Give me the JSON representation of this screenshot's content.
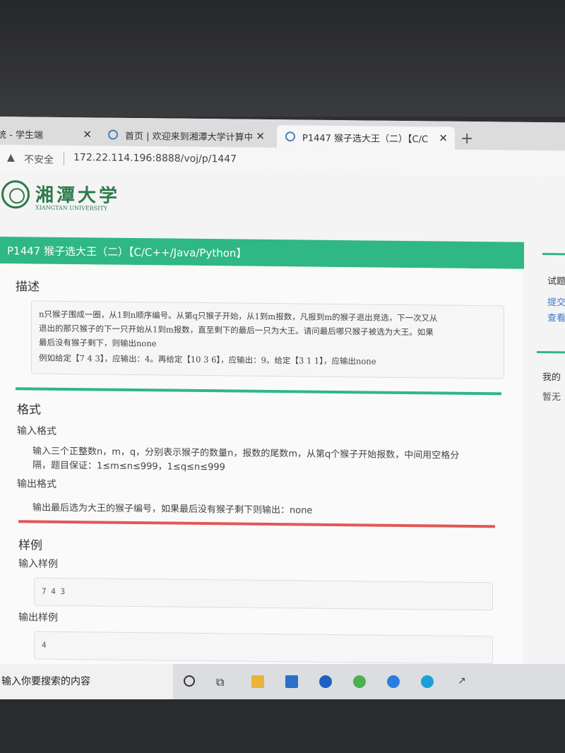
{
  "tabs": [
    {
      "title": "统 - 学生端",
      "close": "✕"
    },
    {
      "title": "首页 | 欢迎来到湘潭大学计算中",
      "close": "✕"
    },
    {
      "title": "P1447 猴子选大王（二）【C/C",
      "close": "✕"
    }
  ],
  "new_tab": "+",
  "address": {
    "security": "不安全",
    "url": "172.22.114.196:8888/voj/p/1447"
  },
  "logo": {
    "cn": "湘潭大学",
    "en": "XIANGTAN UNIVERSITY"
  },
  "problem": {
    "title": "P1447 猴子选大王（二）【C/C++/Java/Python】",
    "desc_heading": "描述",
    "desc_lines": [
      "n只猴子围成一圈，从1到n顺序编号。从第q只猴子开始，从1到m报数，凡报到m的猴子退出竞选，下一次又从",
      "退出的那只猴子的下一只开始从1到m报数，直至剩下的最后一只为大王。请问最后哪只猴子被选为大王。如果",
      "最后没有猴子剩下，则输出none",
      "例如给定【7 4 3】，应输出：4。再给定【10 3 6】，应输出：9。给定【3 1 1】，应输出none"
    ],
    "format_heading": "格式",
    "input_format_heading": "输入格式",
    "input_format_lines": [
      "输入三个正整数n，m，q，分别表示猴子的数量n，报数的尾数m，从第q个猴子开始报数，中间用空格分",
      "隔，题目保证：1≤m≤n≤999，1≤q≤n≤999"
    ],
    "output_format_heading": "输出格式",
    "output_format_text": "输出最后选为大王的猴子编号，如果最后没有猴子剩下则输出：none",
    "samples_heading": "样例",
    "input_sample_heading": "输入样例",
    "input_sample": "7 4 3",
    "output_sample_heading": "输出样例",
    "output_sample": "4"
  },
  "sidebar": {
    "heading1": "试题",
    "link1": "提交",
    "link2": "查看",
    "heading2": "我的",
    "empty": "暂无"
  },
  "taskbar": {
    "search_placeholder": "输入你要搜索的内容"
  }
}
